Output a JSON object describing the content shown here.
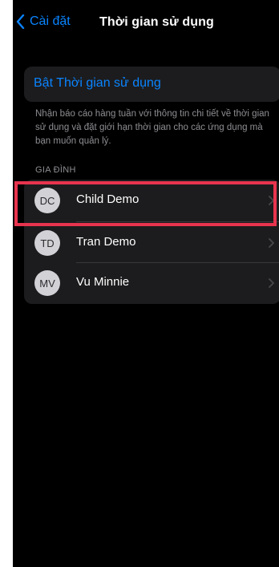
{
  "nav": {
    "back_label": "Cài đặt",
    "title": "Thời gian sử dụng"
  },
  "enable": {
    "label": "Bật Thời gian sử dụng"
  },
  "description": "Nhận báo cáo hàng tuần với thông tin chi tiết về thời gian sử dụng và đặt giới hạn thời gian cho các ứng dụng mà bạn muốn quản lý.",
  "family": {
    "header": "GIA ĐÌNH",
    "members": [
      {
        "initials": "DC",
        "name": "Child Demo"
      },
      {
        "initials": "TD",
        "name": "Tran Demo"
      },
      {
        "initials": "MV",
        "name": "Vu Minnie"
      }
    ]
  },
  "colors": {
    "accent": "#0a84ff",
    "background": "#000000",
    "group_bg": "#1c1c1e",
    "highlight": "#e8344e"
  },
  "icons": {
    "back": "chevron-left-icon",
    "row_disclosure": "chevron-right-icon"
  }
}
